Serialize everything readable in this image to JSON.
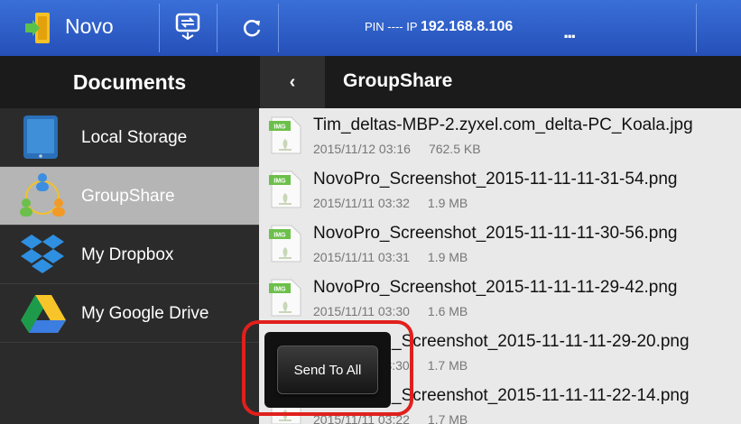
{
  "topbar": {
    "app_name": "Novo",
    "pin_label": "PIN",
    "pin_value": "----",
    "ip_label": "IP",
    "ip_value": "192.168.8.106",
    "more": "..."
  },
  "sidebar": {
    "title": "Documents",
    "items": [
      {
        "label": "Local Storage",
        "icon": "tablet-icon",
        "active": false
      },
      {
        "label": "GroupShare",
        "icon": "groupshare-icon",
        "active": true
      },
      {
        "label": "My Dropbox",
        "icon": "dropbox-icon",
        "active": false
      },
      {
        "label": "My Google Drive",
        "icon": "google-drive-icon",
        "active": false
      }
    ]
  },
  "content": {
    "back": "‹",
    "title": "GroupShare",
    "files": [
      {
        "name": "Tim_deltas-MBP-2.zyxel.com_delta-PC_Koala.jpg",
        "date": "2015/11/12 03:16",
        "size": "762.5 KB"
      },
      {
        "name": "NovoPro_Screenshot_2015-11-11-11-31-54.png",
        "date": "2015/11/11 03:32",
        "size": "1.9 MB"
      },
      {
        "name": "NovoPro_Screenshot_2015-11-11-11-30-56.png",
        "date": "2015/11/11 03:31",
        "size": "1.9 MB"
      },
      {
        "name": "NovoPro_Screenshot_2015-11-11-11-29-42.png",
        "date": "2015/11/11 03:30",
        "size": "1.6 MB"
      },
      {
        "name": "_Screenshot_2015-11-11-11-29-20.png",
        "date": "1 03:30",
        "size": "1.7 MB"
      },
      {
        "name": "_Screenshot_2015-11-11-11-22-14.png",
        "date": "2015/11/11 03:22",
        "size": "1.7 MB"
      }
    ],
    "icon_badge": "IMG"
  },
  "popup": {
    "send_to_all": "Send To All"
  },
  "colors": {
    "topbar": "#2f5fcc",
    "highlight": "#e0201c",
    "icon_badge": "#6cc04a"
  }
}
